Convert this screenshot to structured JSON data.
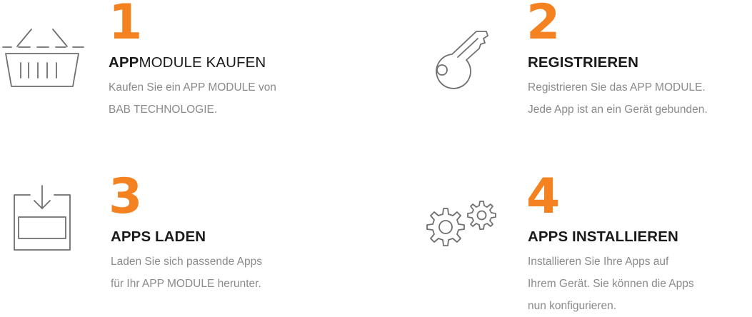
{
  "steps": [
    {
      "number": "1",
      "title_bold": "APP",
      "title_rest": "MODULE KAUFEN",
      "desc_lines": [
        "Kaufen Sie ein APP MODULE von",
        "BAB TECHNOLOGIE."
      ],
      "icon": "basket-icon"
    },
    {
      "number": "2",
      "title": "REGISTRIEREN",
      "desc_lines": [
        "Registrieren Sie das APP MODULE.",
        "Jede App ist an ein Gerät gebunden."
      ],
      "icon": "key-icon"
    },
    {
      "number": "3",
      "title": "APPS LADEN",
      "desc_lines": [
        "Laden Sie sich passende Apps",
        "für Ihr APP MODULE herunter."
      ],
      "icon": "download-tray-icon"
    },
    {
      "number": "4",
      "title": "APPS INSTALLIEREN",
      "desc_lines": [
        "Installieren Sie Ihre Apps auf",
        "Ihrem Gerät. Sie können die Apps",
        "nun konfigurieren."
      ],
      "icon": "gears-icon"
    }
  ],
  "colors": {
    "accent": "#f58220",
    "title": "#1a1a1a",
    "text": "#8a8a8a",
    "icon_stroke": "#6f6f6f"
  }
}
